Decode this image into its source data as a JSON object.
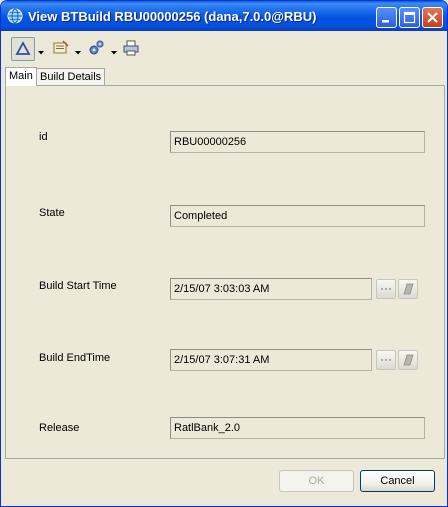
{
  "window": {
    "title": "View BTBuild RBU00000256 (dana,7.0.0@RBU)"
  },
  "titlebar_buttons": [
    "minimize-icon",
    "maximize-icon",
    "close-icon"
  ],
  "toolbar": {
    "icons": [
      "delta-icon",
      "chevron-down-icon",
      "notes-icon",
      "chevron-down-icon",
      "gears-icon",
      "chevron-down-icon",
      "printer-icon"
    ]
  },
  "tabs": [
    {
      "label": "Main",
      "active": true
    },
    {
      "label": "Build Details",
      "active": false
    }
  ],
  "fields": {
    "id": {
      "label": "id",
      "value": "RBU00000256"
    },
    "state": {
      "label": "State",
      "value": "Completed"
    },
    "build_start_time": {
      "label": "Build Start Time",
      "value": "2/15/07 3:03:03 AM"
    },
    "build_end_time": {
      "label": "Build EndTime",
      "value": "2/15/07 3:07:31 AM"
    },
    "release": {
      "label": "Release",
      "value": "RatlBank_2.0"
    }
  },
  "buttons": {
    "ok": "OK",
    "cancel": "Cancel"
  },
  "colors": {
    "titlebar": "#0554e3",
    "window_bg": "#ece9d8",
    "accent": "#0831d9"
  }
}
